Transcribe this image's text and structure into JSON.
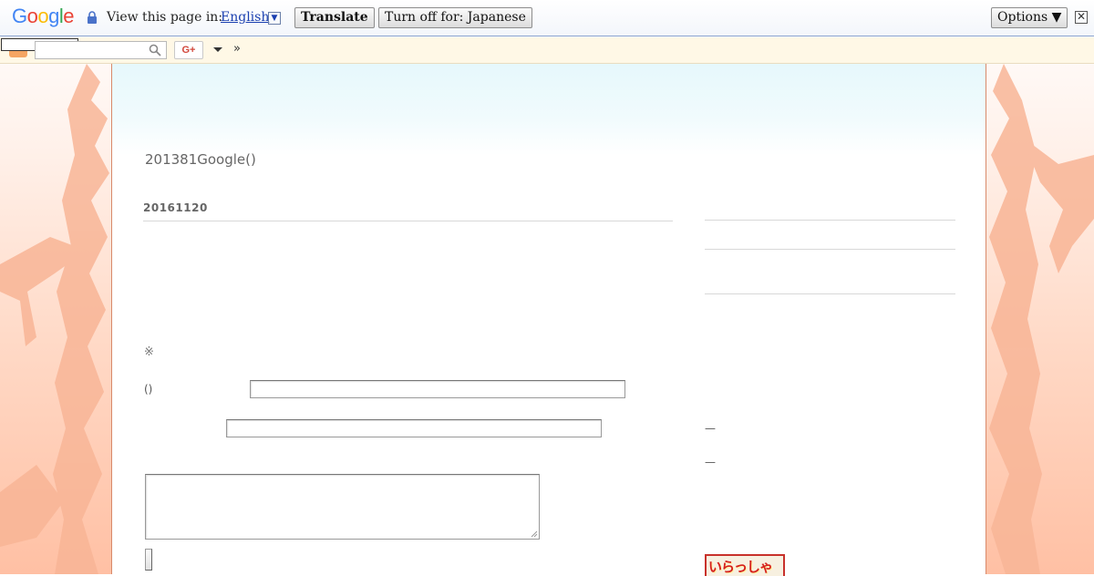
{
  "translate_bar": {
    "logo": "Google",
    "prompt": "View this page in:",
    "language": "English",
    "translate_label": "Translate",
    "turn_off_label": "Turn off for: Japanese",
    "options_label": "Options ▼",
    "close_glyph": "✕"
  },
  "navbar": {
    "more_label": "»",
    "gplus_label": "G+",
    "search_placeholder": ""
  },
  "post": {
    "blog_description": "201381Google()",
    "date_header": "20161120",
    "note_mark": "※",
    "name_label": "()"
  },
  "sidebar": {
    "dash_1": "—",
    "dash_2": "—",
    "badge_text": "いらっしゃいませ"
  },
  "colors": {
    "accent_link": "#1a3fb0",
    "background_peach": "#ffc0a4",
    "header_sky": "#e6f8fc"
  },
  "icons": [
    "lock-icon",
    "search-icon",
    "close-icon",
    "dropdown-arrow-icon",
    "blogger-icon",
    "google-plus-icon"
  ]
}
